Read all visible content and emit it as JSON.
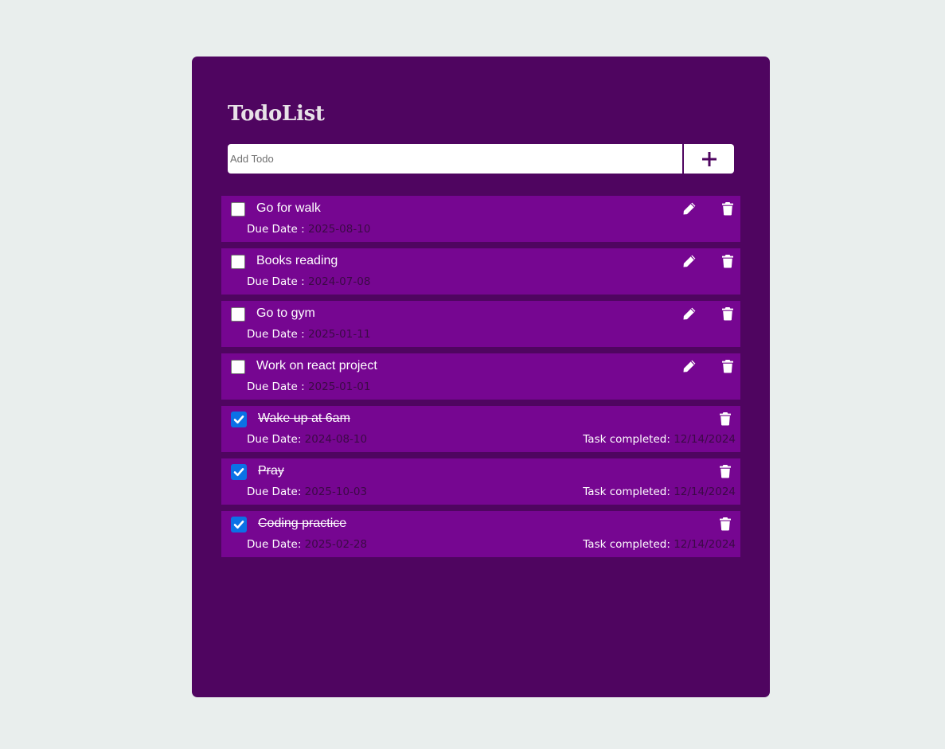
{
  "app": {
    "title": "TodoList"
  },
  "add_form": {
    "placeholder": "Add Todo",
    "add_icon": "plus-icon"
  },
  "labels": {
    "due_open": "Due Date : ",
    "due_done": "Due Date: ",
    "completed": "Task completed: "
  },
  "todos": [
    {
      "text": "Go for walk",
      "due": "2025-08-10",
      "done": false
    },
    {
      "text": "Books reading",
      "due": "2024-07-08",
      "done": false
    },
    {
      "text": "Go to gym",
      "due": "2025-01-11",
      "done": false
    },
    {
      "text": "Work on react project",
      "due": "2025-01-01",
      "done": false
    },
    {
      "text": "Wake up at 6am",
      "due": "2024-08-10",
      "done": true,
      "completed": "12/14/2024"
    },
    {
      "text": "Pray",
      "due": "2025-10-03",
      "done": true,
      "completed": "12/14/2024"
    },
    {
      "text": "Coding practice",
      "due": "2025-02-28",
      "done": true,
      "completed": "12/14/2024"
    }
  ],
  "colors": {
    "page_bg": "#e9eeed",
    "card_bg": "#4f0560",
    "item_bg": "#760691",
    "checkbox_checked": "#0b71e6",
    "date_text": "#3b0a45"
  }
}
